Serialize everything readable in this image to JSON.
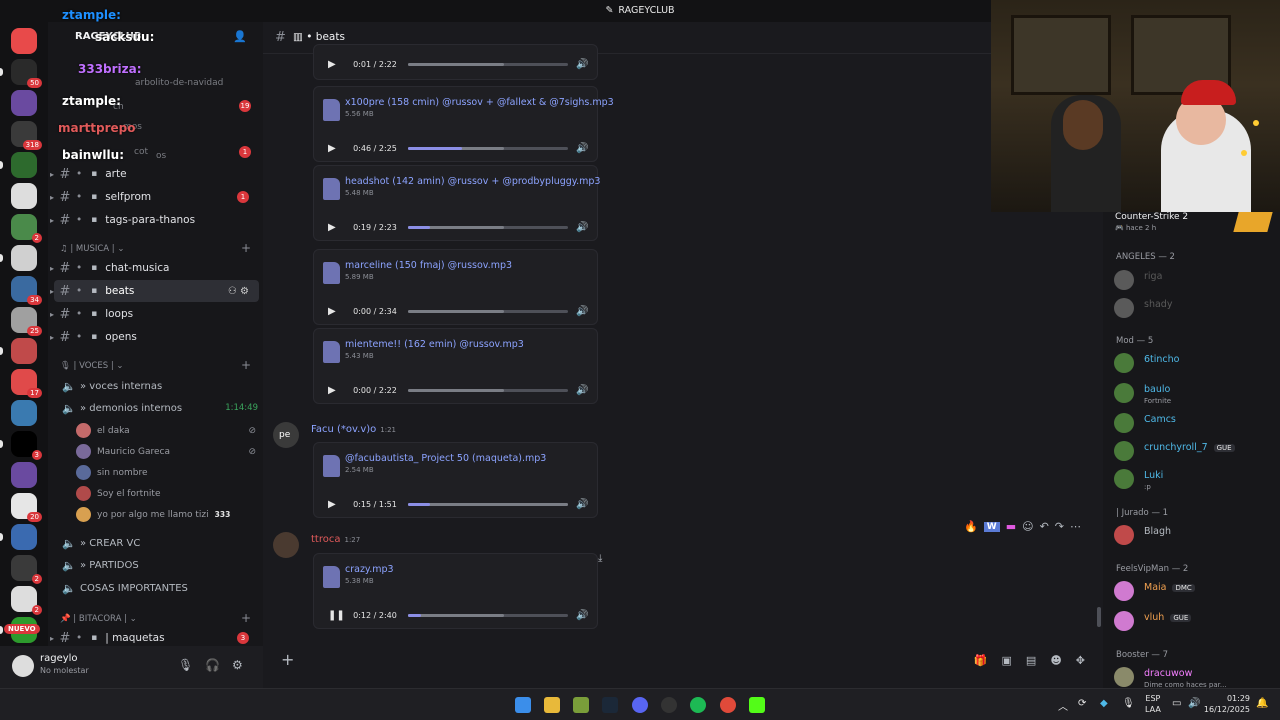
{
  "window": {
    "title": "RAGEYCLUB"
  },
  "server": {
    "name": "RAGEYCLUB"
  },
  "rail_badges": [
    "50",
    "318",
    "2",
    "34",
    "25",
    "17",
    "3",
    "20",
    "2",
    "2"
  ],
  "rail_new_label": "NUEVO",
  "sidebar": {
    "top_channels": [
      {
        "label": "arte",
        "icon": "palette-icon"
      },
      {
        "label": "selfprom",
        "icon": "eyes-icon",
        "badge": "1"
      },
      {
        "label": "tags-para-thanos",
        "icon": "book-icon"
      }
    ],
    "music_category": "| MUSICA |",
    "music_channels": [
      {
        "label": "chat-musica",
        "icon": "music-icon"
      },
      {
        "label": "beats",
        "icon": "piano-icon",
        "active": true
      },
      {
        "label": "loops",
        "icon": "loop-icon"
      },
      {
        "label": "opens",
        "icon": "hammer-icon"
      }
    ],
    "voice_category": "| VOCES |",
    "voice_channels": [
      {
        "label": "» voces internas"
      },
      {
        "label": "» demonios internos",
        "timer": "1:14:49"
      }
    ],
    "voice_users": [
      {
        "name": "el daka",
        "color": "#c46a6a"
      },
      {
        "name": "Mauricio Gareca",
        "color": "#7a6a9a"
      },
      {
        "name": "sin nombre",
        "color": "#5a6a9a"
      },
      {
        "name": "Soy el fortnite",
        "color": "#b04a4a"
      },
      {
        "name": "yo por algo me llamo tizi",
        "color": "#d8a050",
        "extra": "333"
      }
    ],
    "voice_more": [
      {
        "label": "» CREAR VC"
      },
      {
        "label": "» PARTIDOS"
      },
      {
        "label": "COSAS IMPORTANTES"
      }
    ],
    "bitacora_category": "| BITACORA |",
    "bitacora_channel": {
      "label": "| maquetas",
      "badge": "3"
    },
    "misc_badges": [
      "19",
      "1"
    ],
    "hidden_channel_texts": [
      "arbolito-de-navidad",
      "ch",
      "mos",
      "cot",
      "os"
    ]
  },
  "overlay_names": [
    "ztample:",
    "sacksuu:",
    "333briza:",
    "ztample:",
    "marttprepo",
    "bainwllu:"
  ],
  "user": {
    "name": "rageylo",
    "status": "No molestar"
  },
  "channel": {
    "name": "beats"
  },
  "messages": [
    {
      "attachments": [
        {
          "name": null,
          "size": null,
          "time": "0:01 / 2:22",
          "progress": 0.0,
          "buffer": 0.6
        }
      ]
    },
    {
      "attachments": [
        {
          "name": "x100pre (158 cmin) @russov + @fallext & @7sighs.mp3",
          "size": "5.56 MB",
          "time": "0:46 / 2:25",
          "progress": 0.34,
          "buffer": 0.6
        },
        {
          "name": "headshot (142 amin) @russov + @prodbypluggy.mp3",
          "size": "5.48 MB",
          "time": "0:19 / 2:23",
          "progress": 0.14,
          "buffer": 0.6
        },
        {
          "name": "marceline (150 fmaj) @russov.mp3",
          "size": "5.89 MB",
          "time": "0:00 / 2:34",
          "progress": 0.0,
          "buffer": 0.6
        },
        {
          "name": "mienteme!! (162 emin) @russov.mp3",
          "size": "5.43 MB",
          "time": "0:00 / 2:22",
          "progress": 0.0,
          "buffer": 0.6
        }
      ]
    },
    {
      "author": "Facu (*ov.v)o",
      "author_color": "#8ca3ff",
      "time": "1:21",
      "avatar_text": "pe",
      "attachments": [
        {
          "name": "@facubautista_ Project 50 (maqueta).mp3",
          "size": "2.54 MB",
          "time": "0:15 / 1:51",
          "progress": 0.14,
          "buffer": 1.0
        }
      ]
    },
    {
      "author": "ttroca",
      "author_color": "#e05a5a",
      "time": "1:27",
      "attachments": [
        {
          "name": "crazy.mp3",
          "size": "5.38 MB",
          "time": "0:12 / 2:40",
          "progress": 0.08,
          "buffer": 0.6,
          "playing": true
        }
      ]
    }
  ],
  "members": {
    "activity": {
      "game": "Counter-Strike 2",
      "since": "hace 2 h"
    },
    "groups": [
      {
        "label": "ANGELES — 2",
        "members": [
          {
            "name": "riga",
            "color": "#5a5a5a"
          },
          {
            "name": "shady",
            "color": "#5a5a5a"
          }
        ]
      },
      {
        "label": "Mod — 5",
        "members": [
          {
            "name": "6tincho",
            "color": "#4fb9e8",
            "sub": ""
          },
          {
            "name": "baulo",
            "color": "#4fb9e8",
            "sub": "Fortnite"
          },
          {
            "name": "Camcs",
            "color": "#4fb9e8"
          },
          {
            "name": "crunchyroll_7",
            "color": "#4fb9e8",
            "tag": "GUE"
          },
          {
            "name": "Luki",
            "color": "#4fb9e8",
            "sub": ":p"
          }
        ]
      },
      {
        "label": "| Jurado — 1",
        "members": [
          {
            "name": "Blagh",
            "color": "#b5bac1"
          }
        ]
      },
      {
        "label": "FeelsVipMan — 2",
        "members": [
          {
            "name": "Maia",
            "color": "#f0a050",
            "tag": "DMC"
          },
          {
            "name": "vluh",
            "color": "#f0a050",
            "tag": "GUE"
          }
        ]
      },
      {
        "label": "Booster — 7",
        "members": [
          {
            "name": "dracuwow",
            "color": "#f47fff",
            "sub": "Dime como haces par..."
          }
        ]
      }
    ]
  },
  "taskbar": {
    "lang_1": "ESP",
    "lang_2": "LAA",
    "time": "01:29",
    "date": "16/12/2025"
  }
}
